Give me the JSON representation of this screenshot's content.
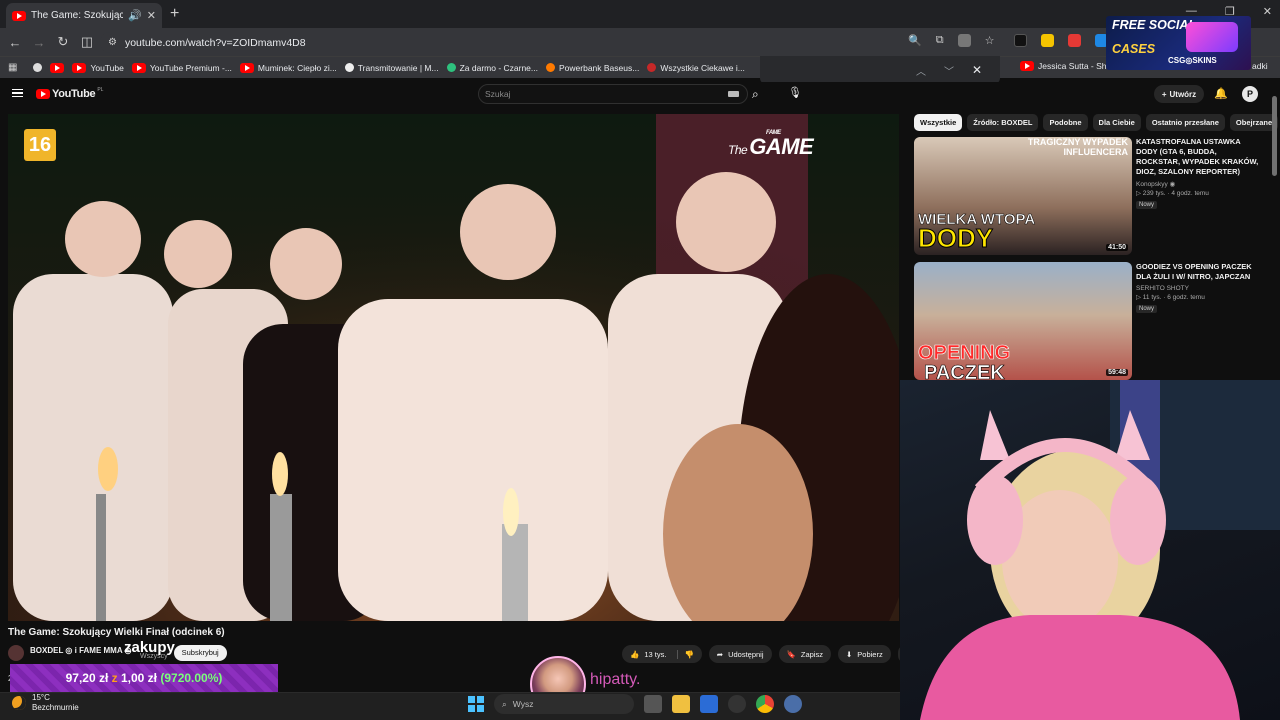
{
  "browser": {
    "tab_title": "The Game: Szokujący Wielki",
    "url": "youtube.com/watch?v=ZOIDmamv4D8",
    "bookmarks": [
      "YouTube",
      "YouTube Premium -...",
      "Muminek: Ciepło zi...",
      "Transmitowanie | M...",
      "Za darmo - Czarne...",
      "Powerbank Baseus...",
      "Wszystkie Ciekawe i...",
      "Jessica Sutta - Show",
      "adki"
    ]
  },
  "youtube": {
    "logo": "YouTube",
    "country": "PL",
    "search_placeholder": "Szukaj",
    "create_label": "Utwórz",
    "avatar_letter": "P"
  },
  "video": {
    "age_rating": "16",
    "overlay_logo_pre": "The",
    "overlay_logo_sup": "FAME",
    "overlay_logo": "GAME",
    "title": "The Game: Szokujący Wielki Finał (odcinek 6)",
    "channel": "BOXDEL ◎ i FAME MMA ◎",
    "subscribers": "Wszyscy",
    "subscribe_label": "Subskrybuj",
    "likes": "13 tys.",
    "share": "Udostępnij",
    "save": "Zapisz",
    "download": "Pobierz",
    "views_prefix": "21t"
  },
  "stream_overlay": {
    "zakupy": "zakupy",
    "donation_amount": "97,20 zł",
    "donation_sep": "z",
    "donation_goal": "1,00 zł",
    "donation_pct": "(9720.00%)",
    "streamer": "hipatty."
  },
  "sidebar": {
    "chips": [
      "Wszystkie",
      "Źródło: BOXDEL",
      "Podobne",
      "Dla Ciebie",
      "Ostatnio przesłane",
      "Obejrzane"
    ],
    "recs": [
      {
        "title": "KATASTROFALNA USTAWKA DODY (GTA 6, BUDDA, ROCKSTAR, WYPADEK KRAKÓW, DIOZ, SZALONY REPORTER)",
        "channel": "Konopskyy ◉",
        "meta": "▷ 239 tys. · 4 godz. temu",
        "badge": "Nowy",
        "duration": "41:50",
        "thumb_text_top": "TRAGICZNY WYPADEK INFLUENCERA",
        "thumb_text_1": "WIELKA WTOPA",
        "thumb_text_2": "DODY"
      },
      {
        "title": "GOODIEZ VS OPENING PACZEK DLA ŻULI I W/ NITRO, JAPCZAN",
        "channel": "SERHITO SHOTY",
        "meta": "▷ 11 tys. · 6 godz. temu",
        "badge": "Nowy",
        "duration": "59:48",
        "thumb_text_1": "OPENING",
        "thumb_text_2": "PACZEK"
      }
    ]
  },
  "ad": {
    "line1": "FREE SOCIAL",
    "line2": "CASES",
    "brand": "CSG◎SKINS"
  },
  "taskbar": {
    "temp": "15°C",
    "weather": "Bezchmurnie",
    "search": "Wysz"
  }
}
